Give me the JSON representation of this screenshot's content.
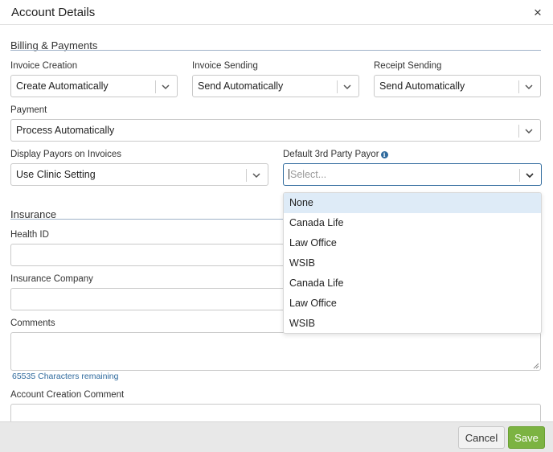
{
  "dialog": {
    "title": "Account Details",
    "close_label": "×"
  },
  "billing": {
    "section_title": "Billing & Payments",
    "invoice_creation": {
      "label": "Invoice Creation",
      "value": "Create Automatically"
    },
    "invoice_sending": {
      "label": "Invoice Sending",
      "value": "Send Automatically"
    },
    "receipt_sending": {
      "label": "Receipt Sending",
      "value": "Send Automatically"
    },
    "payment": {
      "label": "Payment",
      "value": "Process Automatically"
    },
    "display_payors": {
      "label": "Display Payors on Invoices",
      "value": "Use Clinic Setting"
    },
    "default_payor": {
      "label": "Default 3rd Party Payor",
      "info_icon": "i",
      "placeholder": "Select...",
      "options": [
        "None",
        "Canada Life",
        "Law Office",
        "WSIB",
        "Canada Life",
        "Law Office",
        "WSIB"
      ]
    }
  },
  "insurance": {
    "section_title": "Insurance",
    "health_id": {
      "label": "Health ID",
      "value": ""
    },
    "insurance_company": {
      "label": "Insurance Company",
      "value": ""
    },
    "comments": {
      "label": "Comments",
      "value": "",
      "chars_remaining": "65535 Characters remaining"
    },
    "account_creation_comment": {
      "label": "Account Creation Comment",
      "value": ""
    }
  },
  "footer": {
    "cancel_label": "Cancel",
    "save_label": "Save"
  },
  "colors": {
    "accent": "#2f6a9d",
    "save": "#7cb342",
    "highlight": "#deebf7"
  }
}
